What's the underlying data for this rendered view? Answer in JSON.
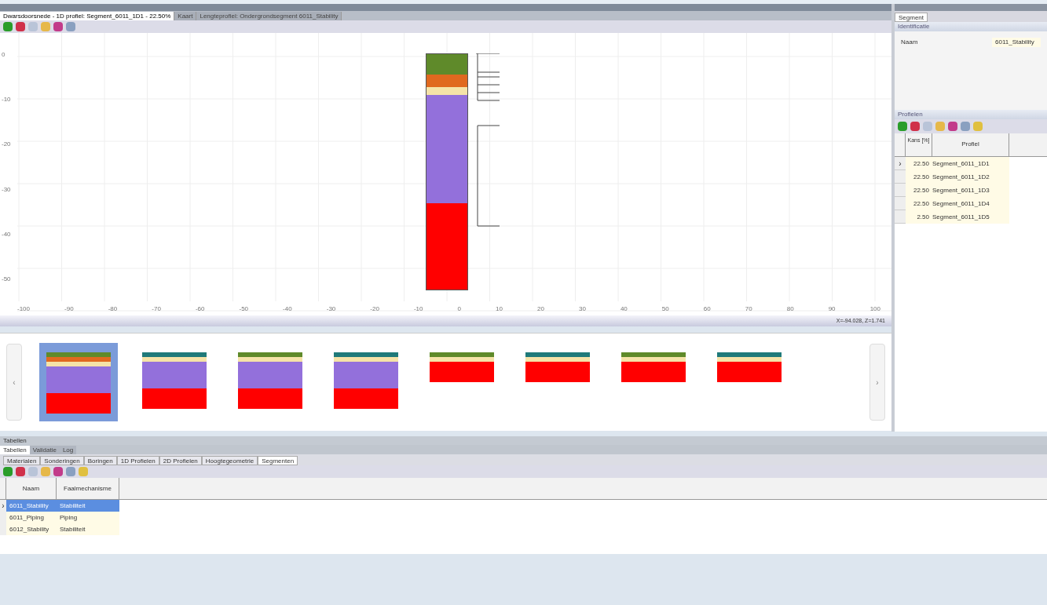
{
  "doc_tabs": [
    {
      "label": "Dwarsdoorsnede - 1D profiel: Segment_6011_1D1 - 22.50%",
      "selected": true
    },
    {
      "label": "Kaart",
      "selected": false
    },
    {
      "label": "Lengteprofiel: Ondergrondsegment 6011_Stability",
      "selected": false
    }
  ],
  "chart": {
    "y_labels": [
      "0",
      "-10",
      "-20",
      "-30",
      "-40",
      "-50"
    ],
    "x_labels": [
      "-100",
      "-90",
      "-80",
      "-70",
      "-60",
      "-50",
      "-40",
      "-30",
      "-20",
      "-10",
      "0",
      "10",
      "20",
      "30",
      "40",
      "50",
      "60",
      "70",
      "80",
      "90",
      "100"
    ],
    "layers": [
      {
        "color": "#5f8a2a",
        "kind": "thick"
      },
      {
        "color": "#e0691f",
        "kind": "mid"
      },
      {
        "color": "#f5e3a8",
        "kind": "thin"
      },
      {
        "color": "#9370db",
        "kind": "deep"
      },
      {
        "color": "#ff0000",
        "kind": "base"
      }
    ],
    "coordinates": "X=-94.028, Z=1.741"
  },
  "thumbnail_nav": {
    "prev": "‹",
    "next": "›"
  },
  "thumbnails": [
    {
      "selected": true,
      "layers": [
        {
          "color": "#5f8a2a",
          "kind": "thin"
        },
        {
          "color": "#e0691f",
          "kind": "thin"
        },
        {
          "color": "#f5e3a8",
          "kind": "thin"
        },
        {
          "color": "#9370db",
          "kind": "deep"
        },
        {
          "color": "#ff0000",
          "kind": "base"
        }
      ]
    },
    {
      "selected": false,
      "layers": [
        {
          "color": "#1f7a7a",
          "kind": "thin"
        },
        {
          "color": "#f5e3a8",
          "kind": "thin"
        },
        {
          "color": "#9370db",
          "kind": "deep"
        },
        {
          "color": "#ff0000",
          "kind": "base"
        }
      ]
    },
    {
      "selected": false,
      "layers": [
        {
          "color": "#5f8a2a",
          "kind": "thin"
        },
        {
          "color": "#f5e3a8",
          "kind": "thin"
        },
        {
          "color": "#9370db",
          "kind": "deep"
        },
        {
          "color": "#ff0000",
          "kind": "base"
        }
      ]
    },
    {
      "selected": false,
      "layers": [
        {
          "color": "#1f7a7a",
          "kind": "thin"
        },
        {
          "color": "#f5e3a8",
          "kind": "thin"
        },
        {
          "color": "#9370db",
          "kind": "deep"
        },
        {
          "color": "#ff0000",
          "kind": "base"
        }
      ]
    },
    {
      "selected": false,
      "layers": [
        {
          "color": "#5f8a2a",
          "kind": "thin"
        },
        {
          "color": "#f5e3a8",
          "kind": "thin"
        },
        {
          "color": "#ff0000",
          "kind": "base"
        }
      ]
    },
    {
      "selected": false,
      "layers": [
        {
          "color": "#1f7a7a",
          "kind": "thin"
        },
        {
          "color": "#f5e3a8",
          "kind": "thin"
        },
        {
          "color": "#ff0000",
          "kind": "base"
        }
      ]
    },
    {
      "selected": false,
      "layers": [
        {
          "color": "#5f8a2a",
          "kind": "thin"
        },
        {
          "color": "#f5e3a8",
          "kind": "thin"
        },
        {
          "color": "#ff0000",
          "kind": "base"
        }
      ]
    },
    {
      "selected": false,
      "layers": [
        {
          "color": "#1f7a7a",
          "kind": "thin"
        },
        {
          "color": "#f5e3a8",
          "kind": "thin"
        },
        {
          "color": "#ff0000",
          "kind": "base"
        }
      ]
    }
  ],
  "right_panel": {
    "tab": {
      "label": "Segment",
      "selected": true
    },
    "section": "Identificatie",
    "field_label": "Naam",
    "field_value": "6011_Stability",
    "profiles_title": "Profielen",
    "row_marker": "›",
    "columns": [
      "Kans [%]",
      "Profiel"
    ],
    "rows": [
      {
        "kans": "22.50",
        "profiel": "Segment_6011_1D1",
        "selected": true
      },
      {
        "kans": "22.50",
        "profiel": "Segment_6011_1D2",
        "selected": false
      },
      {
        "kans": "22.50",
        "profiel": "Segment_6011_1D3",
        "selected": false
      },
      {
        "kans": "22.50",
        "profiel": "Segment_6011_1D4",
        "selected": false
      },
      {
        "kans": "2.50",
        "profiel": "Segment_6011_1D5",
        "selected": false
      }
    ]
  },
  "bottom": {
    "title": "Tabellen",
    "tabs": [
      {
        "label": "Tabellen",
        "selected": true
      },
      {
        "label": "Validatie",
        "selected": false
      },
      {
        "label": "Log",
        "selected": false
      }
    ],
    "sub_tabs": [
      {
        "label": "Materialen",
        "selected": false
      },
      {
        "label": "Sonderingen",
        "selected": false
      },
      {
        "label": "Boringen",
        "selected": false
      },
      {
        "label": "1D Profielen",
        "selected": false
      },
      {
        "label": "2D Profielen",
        "selected": false
      },
      {
        "label": "Hoogtegeometrie",
        "selected": false
      },
      {
        "label": "Segmenten",
        "selected": true
      }
    ],
    "columns": [
      "Naam",
      "Faalmechanisme"
    ],
    "row_marker": "›",
    "rows": [
      {
        "naam": "6011_Stability",
        "mech": "Stabiliteit",
        "selected": true
      },
      {
        "naam": "6011_Piping",
        "mech": "Piping",
        "selected": false
      },
      {
        "naam": "6012_Stability",
        "mech": "Stabiliteit",
        "selected": false
      }
    ]
  }
}
